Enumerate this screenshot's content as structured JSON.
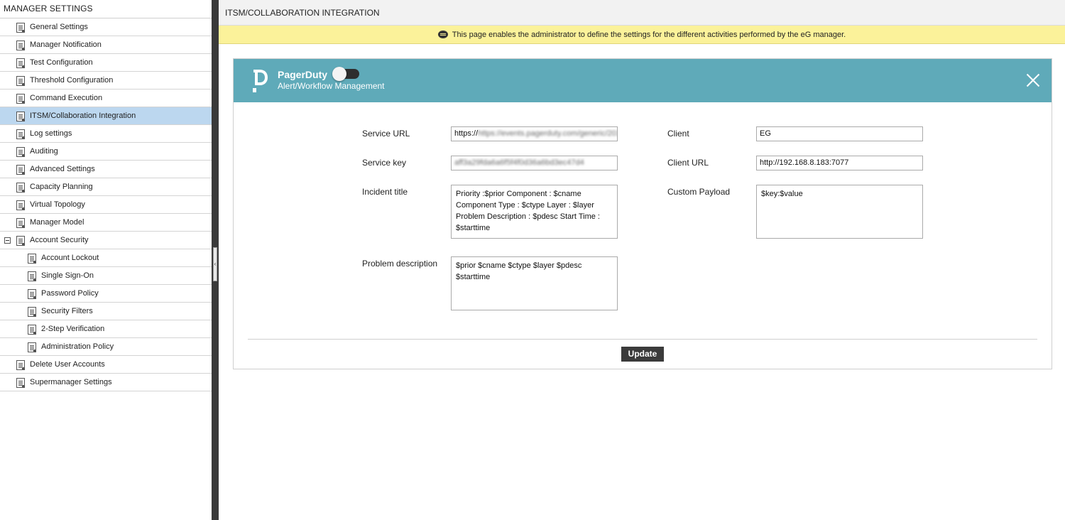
{
  "sidebar": {
    "title": "MANAGER SETTINGS",
    "items": [
      {
        "label": "General Settings"
      },
      {
        "label": "Manager Notification"
      },
      {
        "label": "Test Configuration"
      },
      {
        "label": "Threshold Configuration"
      },
      {
        "label": "Command Execution"
      },
      {
        "label": "ITSM/Collaboration Integration",
        "selected": true
      },
      {
        "label": "Log settings"
      },
      {
        "label": "Auditing"
      },
      {
        "label": "Advanced Settings"
      },
      {
        "label": "Capacity Planning"
      },
      {
        "label": "Virtual Topology"
      },
      {
        "label": "Manager Model"
      },
      {
        "label": "Account Security",
        "expanded": true
      },
      {
        "label": "Account Lockout"
      },
      {
        "label": "Single Sign-On"
      },
      {
        "label": "Password Policy"
      },
      {
        "label": "Security Filters"
      },
      {
        "label": "2-Step Verification"
      },
      {
        "label": "Administration Policy"
      },
      {
        "label": "Delete User Accounts"
      },
      {
        "label": "Supermanager Settings"
      }
    ]
  },
  "splitter": {
    "handle": "‹"
  },
  "header": {
    "title": "ITSM/COLLABORATION INTEGRATION"
  },
  "info_bar": {
    "text": "This page enables the administrator to define the settings for the different activities performed by the eG manager."
  },
  "integration": {
    "name": "PagerDuty",
    "subtitle": "Alert/Workflow Management",
    "enabled": false,
    "header_color": "#5faab9",
    "fields": {
      "service_url": {
        "label": "Service URL",
        "value": "https://events.pagerduty.com/generic/2010"
      },
      "service_key": {
        "label": "Service key",
        "value": "aff3a29fda6a6f5f4f0d36a6bd3ec47d4"
      },
      "incident_title": {
        "label": "Incident title",
        "value": "Priority :$prior Component : $cname Component Type : $ctype Layer : $layer Problem Description : $pdesc Start Time : $starttime"
      },
      "problem_description": {
        "label": "Problem description",
        "value": "$prior $cname $ctype $layer $pdesc $starttime"
      },
      "client": {
        "label": "Client",
        "value": "EG"
      },
      "client_url": {
        "label": "Client URL",
        "value": "http://192.168.8.183:7077"
      },
      "custom_payload": {
        "label": "Custom Payload",
        "value": "$key:$value"
      }
    },
    "update_label": "Update"
  }
}
